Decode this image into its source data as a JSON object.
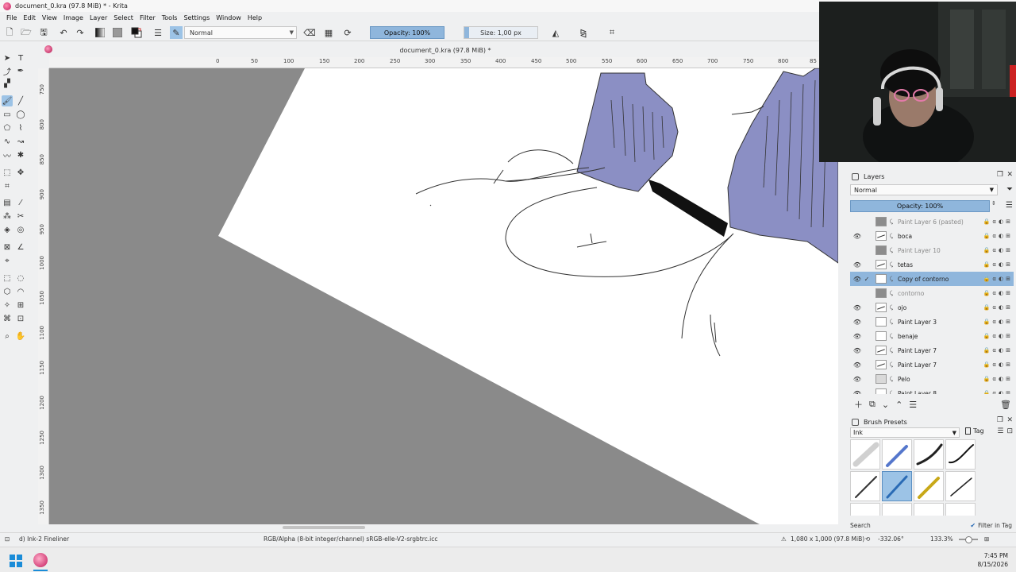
{
  "window": {
    "title": "document_0.kra (97.8 MiB) * - Krita",
    "controls": [
      "—",
      "☐",
      "✕"
    ]
  },
  "menu": [
    "File",
    "Edit",
    "View",
    "Image",
    "Layer",
    "Select",
    "Filter",
    "Tools",
    "Settings",
    "Window",
    "Help"
  ],
  "toolbar": {
    "blend_mode": "Normal",
    "opacity_label": "Opacity: 100%",
    "size_label": "Size: 1,00 px"
  },
  "document_tab": "document_0.kra (97.8 MiB) *",
  "ruler": {
    "top": [
      "0",
      "50",
      "100",
      "150",
      "200",
      "250",
      "300",
      "350",
      "400",
      "450",
      "500",
      "550",
      "600",
      "650",
      "700",
      "750",
      "800",
      "85"
    ],
    "left": [
      "750",
      "800",
      "850",
      "900",
      "950",
      "1000",
      "1050",
      "1100",
      "1150",
      "1200",
      "1250",
      "1300",
      "1350"
    ]
  },
  "layers_docker": {
    "title": "Layers",
    "blend_mode": "Normal",
    "opacity": "Opacity: 100%",
    "layers": [
      {
        "name": "Paint Layer 6 (pasted)",
        "visible": false,
        "thumb": "grey"
      },
      {
        "name": "boca",
        "visible": true,
        "thumb": "line"
      },
      {
        "name": "Paint Layer 10",
        "visible": false,
        "thumb": "grey"
      },
      {
        "name": "tetas",
        "visible": true,
        "thumb": "line"
      },
      {
        "name": "Copy of contorno",
        "visible": true,
        "thumb": "white",
        "selected": true
      },
      {
        "name": "contorno",
        "visible": false,
        "thumb": "grey"
      },
      {
        "name": "ojo",
        "visible": true,
        "thumb": "line"
      },
      {
        "name": "Paint Layer 3",
        "visible": true,
        "thumb": "white"
      },
      {
        "name": "benaje",
        "visible": true,
        "thumb": "white"
      },
      {
        "name": "Paint Layer 7",
        "visible": true,
        "thumb": "line"
      },
      {
        "name": "Paint Layer 7",
        "visible": true,
        "thumb": "line"
      },
      {
        "name": "Pelo",
        "visible": true,
        "thumb": "fill"
      },
      {
        "name": "Paint Layer 8",
        "visible": true,
        "thumb": "white"
      }
    ]
  },
  "brush_docker": {
    "title": "Brush Presets",
    "tag": "Ink",
    "tag_button": "Tag",
    "search_label": "Search",
    "filter_in_tag": "Filter in Tag"
  },
  "status": {
    "brush": "d) Ink-2 Fineliner",
    "color_profile": "RGB/Alpha (8-bit integer/channel)  sRGB-elle-V2-srgbtrc.icc",
    "doc_size": "1,080 x 1,000 (97.8 MiB)",
    "rotation": "-332.06°",
    "zoom": "133.3%"
  },
  "taskbar": {
    "time": "7:45 PM",
    "date": "8/15/2026"
  },
  "colors": {
    "accent": "#8fb6dc",
    "canvas_bg": "#8a8a8a",
    "fill_purple": "#8b8fc4"
  }
}
